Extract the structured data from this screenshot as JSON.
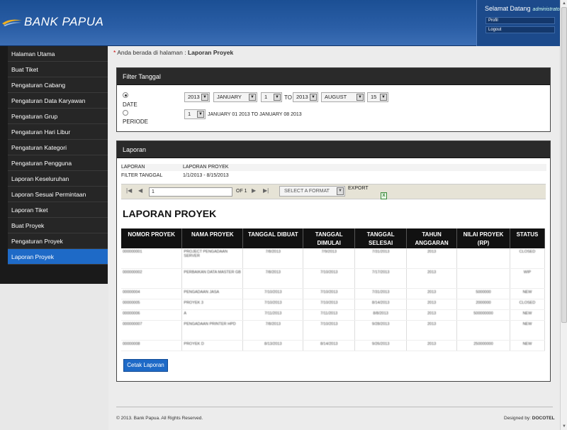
{
  "header": {
    "brand": "BANK PAPUA",
    "welcome": "Selamat Datang",
    "user": "administrator",
    "links": [
      "Profil",
      "Logout"
    ],
    "bg": "#1b4f94"
  },
  "sidebar": {
    "items": [
      {
        "label": "Halaman Utama"
      },
      {
        "label": "Buat Tiket"
      },
      {
        "label": "Pengaturan Cabang"
      },
      {
        "label": "Pengaturan Data Karyawan"
      },
      {
        "label": "Pengaturan Grup"
      },
      {
        "label": "Pengaturan Hari Libur"
      },
      {
        "label": "Pengaturan Kategori"
      },
      {
        "label": "Pengaturan Pengguna"
      },
      {
        "label": "Laporan Keseluruhan"
      },
      {
        "label": "Laporan Sesuai Permintaan"
      },
      {
        "label": "Laporan Tiket"
      },
      {
        "label": "Buat Proyek"
      },
      {
        "label": "Pengaturan Proyek"
      },
      {
        "label": "Laporan Proyek",
        "active": true
      }
    ],
    "active_color": "#1e6ac7"
  },
  "breadcrumb": {
    "star": "*",
    "prefix": "Anda berada di halaman :",
    "page": "Laporan Proyek"
  },
  "filter": {
    "title": "Filter Tanggal",
    "date_label": "DATE",
    "periode_label": "PERIODE",
    "from_year": "2013",
    "from_month": "JANUARY",
    "from_day": "1",
    "to_label": "TO",
    "to_year": "2013",
    "to_month": "AUGUST",
    "to_day": "15",
    "periode_value": "1",
    "periode_text": "JANUARY 01 2013 TO JANUARY 08 2013"
  },
  "report": {
    "title": "Laporan",
    "laporan_label": "LAPORAN",
    "laporan_value": "LAPORAN PROYEK",
    "filter_label": "FILTER TANGGAL",
    "filter_value": "1/1/2013 - 8/15/2013",
    "page_input": "1",
    "of_text": "OF 1",
    "format_placeholder": "SELECT A FORMAT",
    "export_label": "EXPORT",
    "heading": "LAPORAN PROYEK",
    "columns": [
      "NOMOR PROYEK",
      "NAMA PROYEK",
      "TANGGAL DIBUAT",
      "TANGGAL DIMULAI",
      "TANGGAL SELESAI",
      "TAHUN ANGGARAN",
      "NILAI PROYEK (RP)",
      "STATUS"
    ],
    "rows": [
      [
        "000000001",
        "PROJECT PENGADAAN SERVER",
        "7/8/2013",
        "7/9/2013",
        "7/31/2013",
        "2013",
        "",
        "CLOSED"
      ],
      [
        "000000002",
        "PERBAIKAN DATA MASTER GB",
        "7/8/2013",
        "7/10/2013",
        "7/17/2013",
        "2013",
        "",
        "WIP"
      ],
      [
        "00000004",
        "PENGADAAN JASA",
        "7/10/2013",
        "7/10/2013",
        "7/31/2013",
        "2013",
        "5000000",
        "NEW"
      ],
      [
        "00000005",
        "PROYEK 3",
        "7/10/2013",
        "7/10/2013",
        "8/14/2013",
        "2013",
        "2000000",
        "CLOSED"
      ],
      [
        "00000006",
        "A",
        "7/11/2013",
        "7/11/2013",
        "8/8/2013",
        "2013",
        "500000000",
        "NEW"
      ],
      [
        "000000007",
        "PENGADAAN PRINTER HPD",
        "7/8/2013",
        "7/10/2013",
        "9/28/2013",
        "2013",
        "",
        "NEW"
      ],
      [
        "00000008",
        "PROYEK D",
        "8/13/2013",
        "8/14/2013",
        "9/26/2013",
        "2013",
        "250000000",
        "NEW"
      ]
    ],
    "print_button": "Cetak Laporan"
  },
  "footer": {
    "copyright": "© 2013. Bank Papua. All Rights Reserved.",
    "designed_label": "Designed by:",
    "designer": "DOCOTEL"
  },
  "icons": [
    "bank-papua-logo-icon",
    "first-page-icon",
    "prev-page-icon",
    "next-page-icon",
    "last-page-icon",
    "excel-export-icon",
    "dropdown-arrow-icon"
  ]
}
